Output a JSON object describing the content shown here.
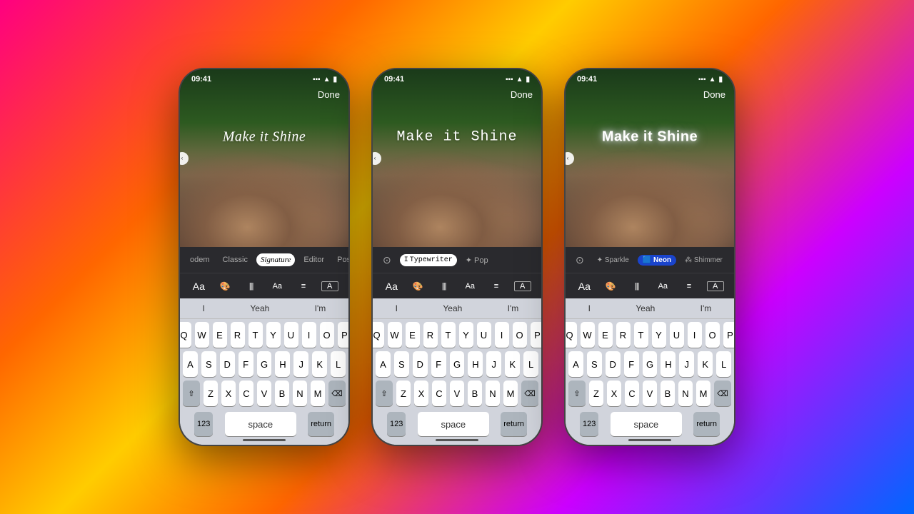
{
  "phones": [
    {
      "id": "phone1",
      "time": "09:41",
      "done_label": "Done",
      "main_text": "Make it Shine",
      "text_style": "classic",
      "has_cursor": true,
      "style_picker": [
        {
          "label": "odem",
          "active": false,
          "style": ""
        },
        {
          "label": "Classic",
          "active": false,
          "style": ""
        },
        {
          "label": "Signature",
          "active": true,
          "style": "signature"
        },
        {
          "label": "Editor",
          "active": false,
          "style": ""
        },
        {
          "label": "Pos...",
          "active": false,
          "style": ""
        }
      ],
      "tools": [
        "Aa",
        "🎨",
        "III",
        "Aa",
        "≡",
        "A"
      ],
      "suggestions": [
        "I",
        "Yeah",
        "I'm"
      ],
      "keyboard_rows": [
        [
          "Q",
          "W",
          "E",
          "R",
          "T",
          "Y",
          "U",
          "I",
          "O",
          "P"
        ],
        [
          "A",
          "S",
          "D",
          "F",
          "G",
          "H",
          "J",
          "K",
          "L"
        ],
        [
          "⇧",
          "Z",
          "X",
          "C",
          "V",
          "B",
          "N",
          "M",
          "⌫"
        ]
      ],
      "bottom_keys": [
        "123",
        "space",
        "return"
      ]
    },
    {
      "id": "phone2",
      "time": "09:41",
      "done_label": "Done",
      "main_text": "Make it Shine",
      "text_style": "typewriter",
      "has_cursor": false,
      "style_picker": [
        {
          "label": "⊙",
          "active": false,
          "style": "icon"
        },
        {
          "label": "Typewriter",
          "active": true,
          "style": "typewriter-label"
        },
        {
          "label": "✦ Pop",
          "active": false,
          "style": ""
        }
      ],
      "tools": [
        "Aa",
        "🎨",
        "III",
        "Aa",
        "≡",
        "A"
      ],
      "suggestions": [
        "I",
        "Yeah",
        "I'm"
      ],
      "keyboard_rows": [
        [
          "Q",
          "W",
          "E",
          "R",
          "T",
          "Y",
          "U",
          "I",
          "O",
          "P"
        ],
        [
          "A",
          "S",
          "D",
          "F",
          "G",
          "H",
          "J",
          "K",
          "L"
        ],
        [
          "⇧",
          "Z",
          "X",
          "C",
          "V",
          "B",
          "N",
          "M",
          "⌫"
        ]
      ],
      "bottom_keys": [
        "123",
        "space",
        "return"
      ]
    },
    {
      "id": "phone3",
      "time": "09:41",
      "done_label": "Done",
      "main_text": "Make it Shine",
      "text_style": "neon",
      "has_cursor": false,
      "style_picker": [
        {
          "label": "⊙",
          "active": false,
          "style": "icon"
        },
        {
          "label": "✦ Sparkle",
          "active": false,
          "style": ""
        },
        {
          "label": "Neon",
          "active": true,
          "style": "neon-active"
        },
        {
          "label": "⁂ Shimmer",
          "active": false,
          "style": "shimmer-label"
        }
      ],
      "tools": [
        "Aa",
        "🎨",
        "III",
        "Aa",
        "≡",
        "A"
      ],
      "suggestions": [
        "I",
        "Yeah",
        "I'm"
      ],
      "keyboard_rows": [
        [
          "Q",
          "W",
          "E",
          "R",
          "T",
          "Y",
          "U",
          "I",
          "O",
          "P"
        ],
        [
          "A",
          "S",
          "D",
          "F",
          "G",
          "H",
          "J",
          "K",
          "L"
        ],
        [
          "⇧",
          "Z",
          "X",
          "C",
          "V",
          "B",
          "N",
          "M",
          "⌫"
        ]
      ],
      "bottom_keys": [
        "123",
        "space",
        "return"
      ]
    }
  ]
}
